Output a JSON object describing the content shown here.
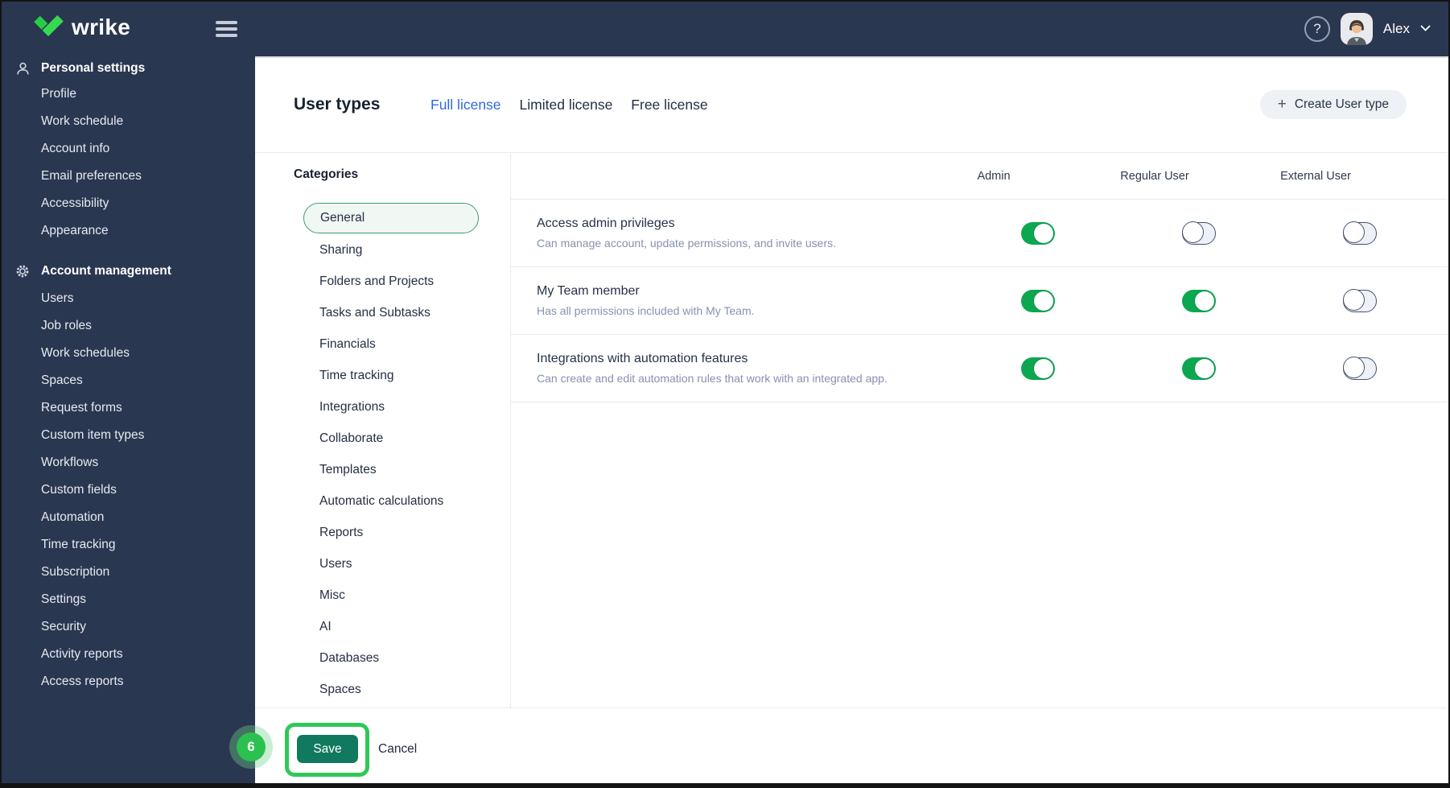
{
  "topbar": {
    "brand": "wrike",
    "help_label": "?",
    "user_name": "Alex"
  },
  "sidebar": {
    "sections": [
      {
        "label": "Personal settings",
        "icon": "person-icon",
        "items": [
          "Profile",
          "Work schedule",
          "Account info",
          "Email preferences",
          "Accessibility",
          "Appearance"
        ]
      },
      {
        "label": "Account management",
        "icon": "gear-icon",
        "items": [
          "Users",
          "Job roles",
          "Work schedules",
          "Spaces",
          "Request forms",
          "Custom item types",
          "Workflows",
          "Custom fields",
          "Automation",
          "Time tracking",
          "Subscription",
          "Settings",
          "Security",
          "Activity reports",
          "Access reports"
        ]
      }
    ]
  },
  "header": {
    "title": "User types",
    "tabs": [
      {
        "label": "Full license",
        "active": true
      },
      {
        "label": "Limited license",
        "active": false
      },
      {
        "label": "Free license",
        "active": false
      }
    ],
    "create_plus": "+",
    "create_button": "Create User type"
  },
  "categories": {
    "heading": "Categories",
    "selected": "General",
    "items": [
      "General",
      "Sharing",
      "Folders and Projects",
      "Tasks and Subtasks",
      "Financials",
      "Time tracking",
      "Integrations",
      "Collaborate",
      "Templates",
      "Automatic calculations",
      "Reports",
      "Users",
      "Misc",
      "AI",
      "Databases",
      "Spaces"
    ]
  },
  "permissions_table": {
    "columns": [
      "Admin",
      "Regular User",
      "External User"
    ],
    "rows": [
      {
        "title": "Access admin privileges",
        "description": "Can manage account, update permissions, and invite users.",
        "toggles": [
          true,
          false,
          false
        ]
      },
      {
        "title": "My Team member",
        "description": "Has all permissions included with My Team.",
        "toggles": [
          true,
          true,
          false
        ]
      },
      {
        "title": "Integrations with automation features",
        "description": "Can create and edit automation rules that work with an integrated app.",
        "toggles": [
          true,
          true,
          false
        ]
      }
    ]
  },
  "footer": {
    "save_label": "Save",
    "cancel_label": "Cancel",
    "step_badge": "6"
  },
  "colors": {
    "navy": "#2a3750",
    "accent_blue": "#2e6ae2",
    "toggle_on_green": "#0ca750",
    "save_green": "#11795e",
    "annotation_green": "#2fc858",
    "category_selected_border": "#3a9e6e"
  }
}
